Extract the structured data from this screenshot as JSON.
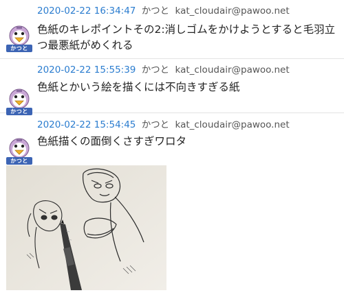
{
  "posts": [
    {
      "timestamp": "2020-02-22 16:34:47",
      "display_name": "かつと",
      "acct": "kat_cloudair@pawoo.net",
      "text": "色紙のキレポイントその2:消しゴムをかけようとすると毛羽立つ最悪紙がめくれる",
      "avatar_label": "かつと"
    },
    {
      "timestamp": "2020-02-22 15:55:39",
      "display_name": "かつと",
      "acct": "kat_cloudair@pawoo.net",
      "text": "色紙とかいう絵を描くには不向きすぎる紙",
      "avatar_label": "かつと"
    },
    {
      "timestamp": "2020-02-22 15:54:45",
      "display_name": "かつと",
      "acct": "kat_cloudair@pawoo.net",
      "text": "色紙描くの面倒くさすぎワロタ",
      "avatar_label": "かつと",
      "attachment": "sketch-photo"
    }
  ],
  "colors": {
    "timestamp": "#2a7ccf",
    "meta": "#555555",
    "avatar_tag": "#3c64b4",
    "divider": "#e3e3e3"
  }
}
